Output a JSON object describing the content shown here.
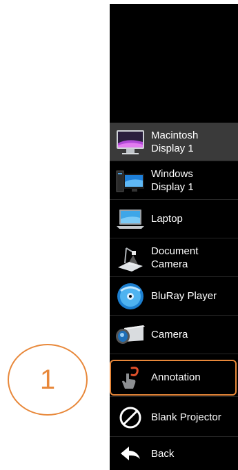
{
  "menu": {
    "items": [
      {
        "label": "Macintosh\nDisplay 1",
        "icon": "imac-monitor-icon",
        "selected": true
      },
      {
        "label": "Windows\nDisplay 1",
        "icon": "windows-pc-icon",
        "selected": false
      },
      {
        "label": "Laptop",
        "icon": "laptop-icon",
        "selected": false
      },
      {
        "label": "Document\nCamera",
        "icon": "document-camera-icon",
        "selected": false
      },
      {
        "label": "BluRay Player",
        "icon": "bluray-disc-icon",
        "selected": false
      },
      {
        "label": "Camera",
        "icon": "video-camera-icon",
        "selected": false
      },
      {
        "label": "Annotation",
        "icon": "annotation-pointer-icon",
        "selected": false
      },
      {
        "label": "Blank Projector",
        "icon": "blank-no-sign-icon",
        "selected": false
      },
      {
        "label": "Back",
        "icon": "back-arrow-icon",
        "selected": false
      }
    ]
  },
  "callout": {
    "number": "1"
  },
  "colors": {
    "accent": "#e8883a",
    "panel": "#000000",
    "selected": "#3a3a3a"
  }
}
